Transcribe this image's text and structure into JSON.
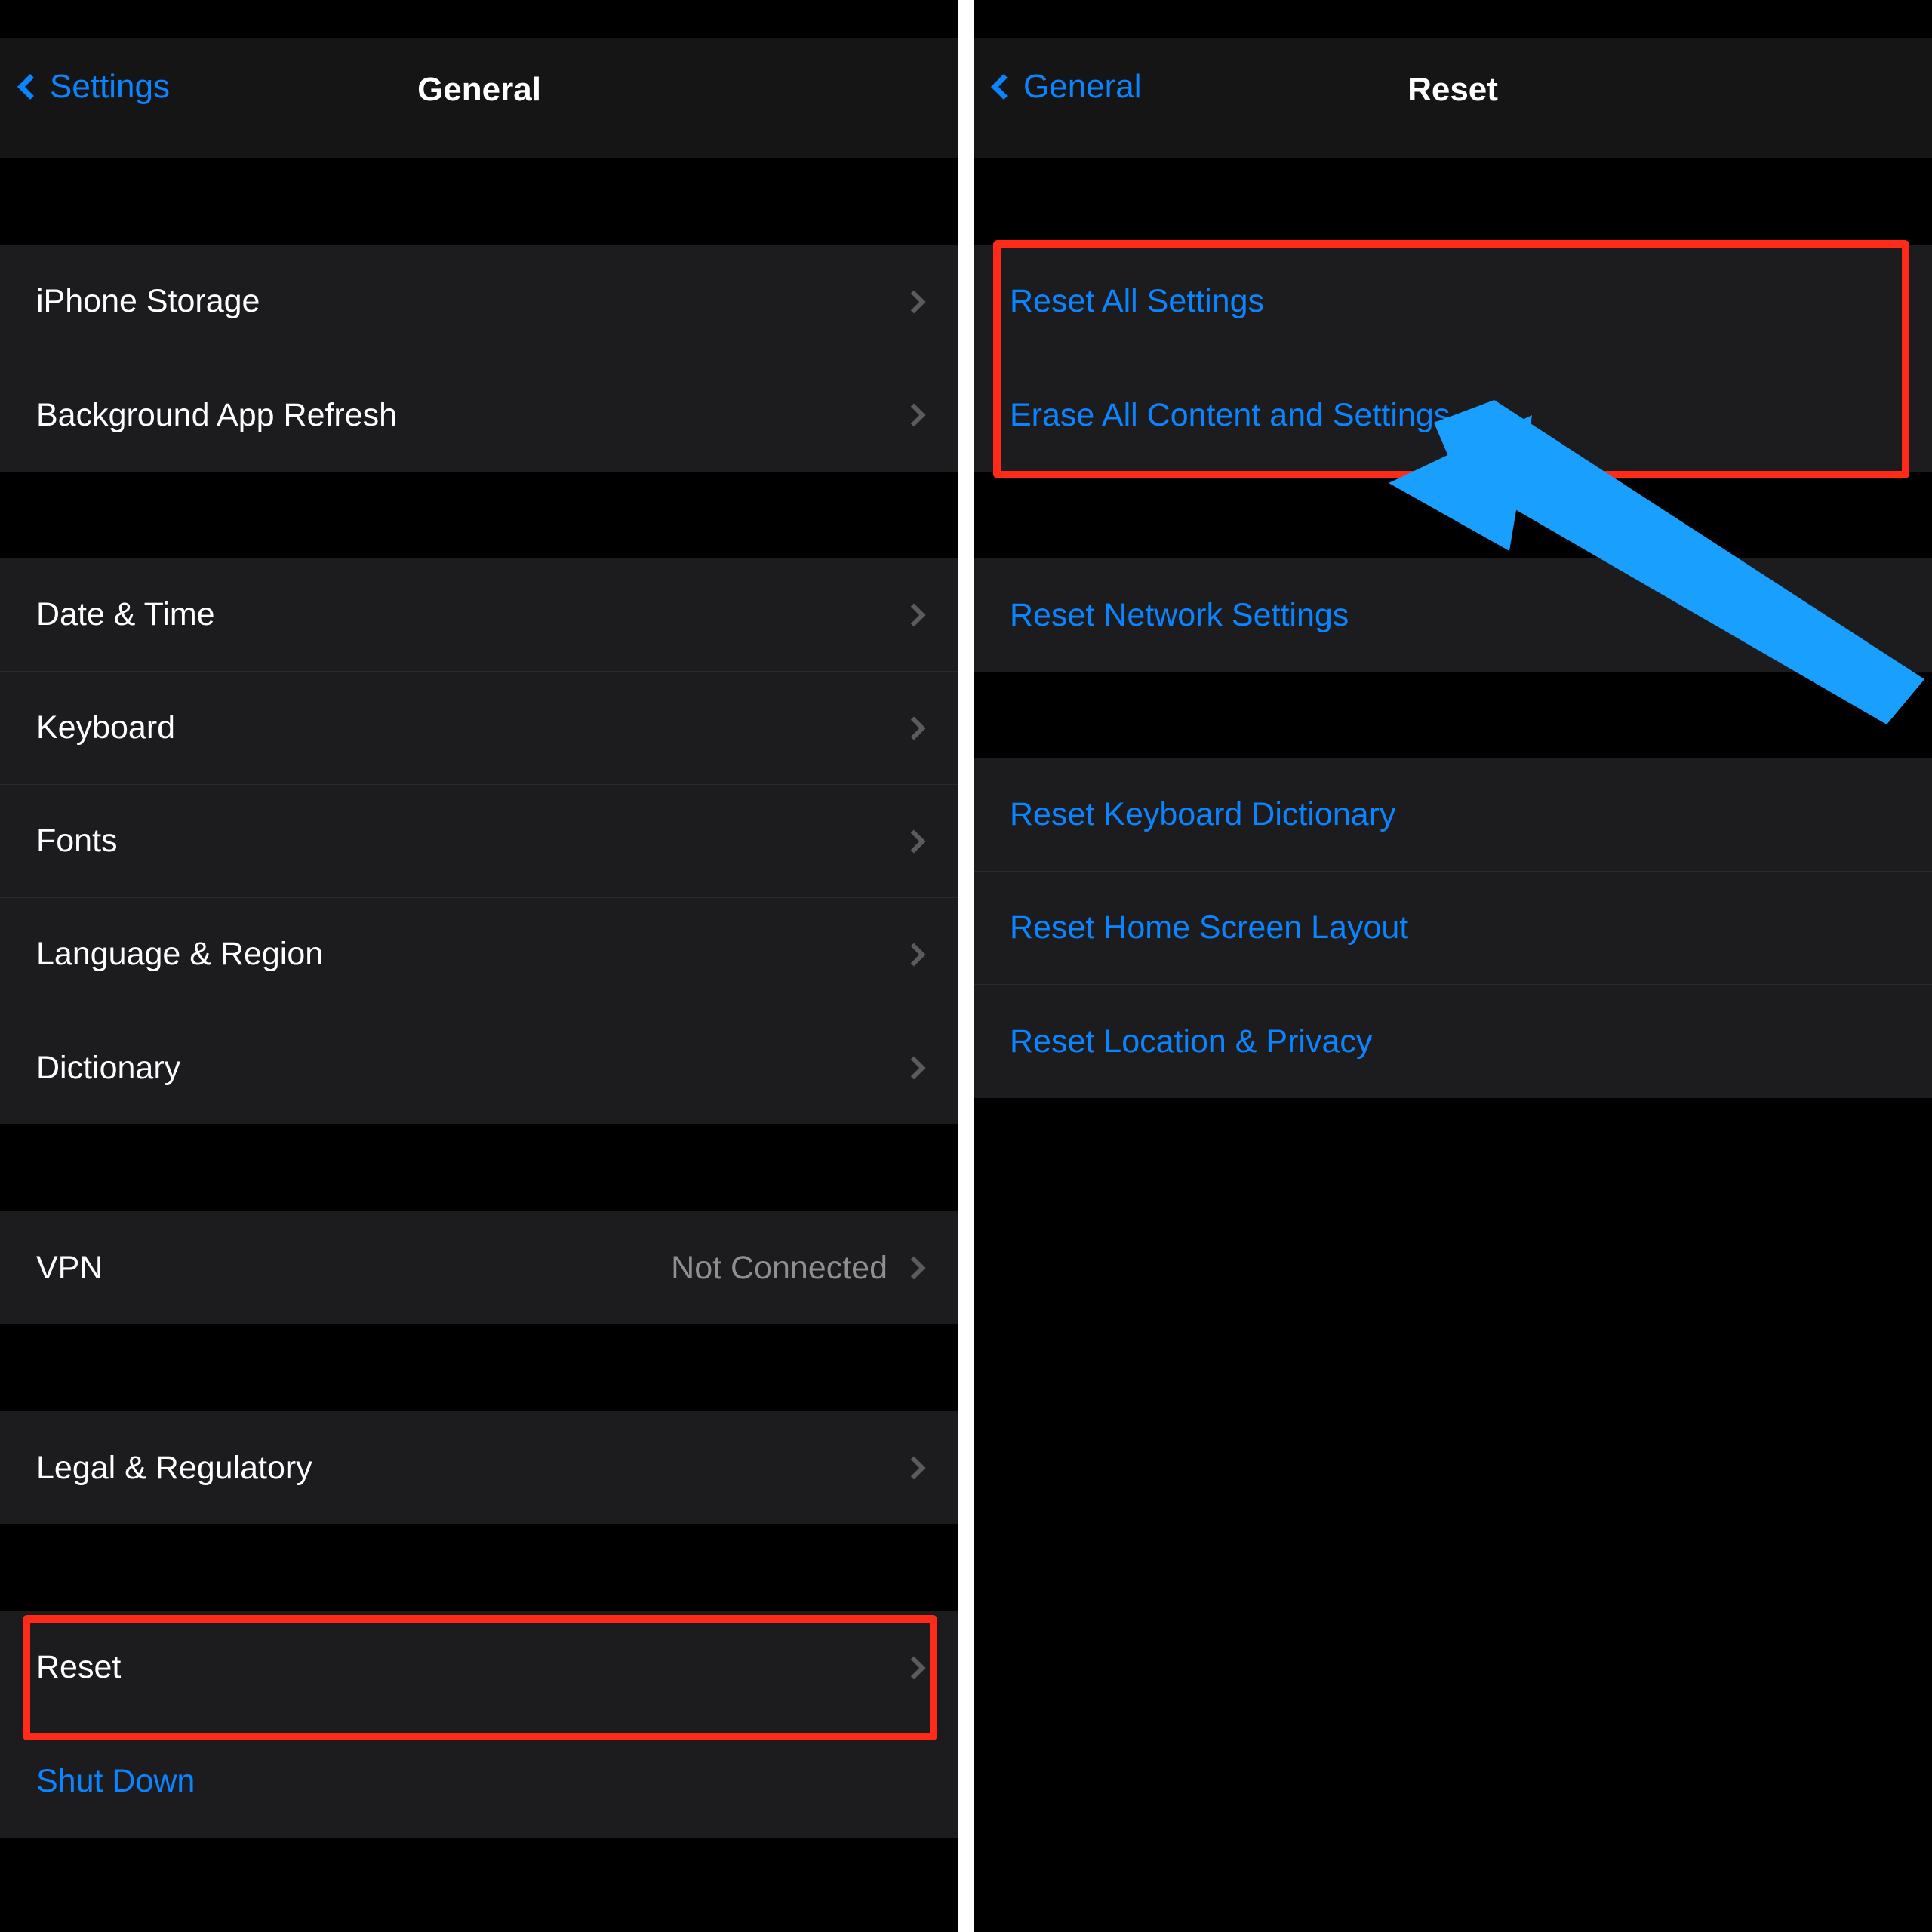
{
  "left": {
    "nav": {
      "back": "Settings",
      "title": "General"
    },
    "group1": [
      {
        "label": "iPhone Storage"
      },
      {
        "label": "Background App Refresh"
      }
    ],
    "group2": [
      {
        "label": "Date & Time"
      },
      {
        "label": "Keyboard"
      },
      {
        "label": "Fonts"
      },
      {
        "label": "Language & Region"
      },
      {
        "label": "Dictionary"
      }
    ],
    "group3": [
      {
        "label": "VPN",
        "value": "Not Connected"
      }
    ],
    "group4": [
      {
        "label": "Legal & Regulatory"
      }
    ],
    "group5": [
      {
        "label": "Reset"
      },
      {
        "label": "Shut Down"
      }
    ]
  },
  "right": {
    "nav": {
      "back": "General",
      "title": "Reset"
    },
    "group1": [
      {
        "label": "Reset All Settings"
      },
      {
        "label": "Erase All Content and Settings"
      }
    ],
    "group2": [
      {
        "label": "Reset Network Settings"
      }
    ],
    "group3": [
      {
        "label": "Reset Keyboard Dictionary"
      },
      {
        "label": "Reset Home Screen Layout"
      },
      {
        "label": "Reset Location & Privacy"
      }
    ]
  }
}
